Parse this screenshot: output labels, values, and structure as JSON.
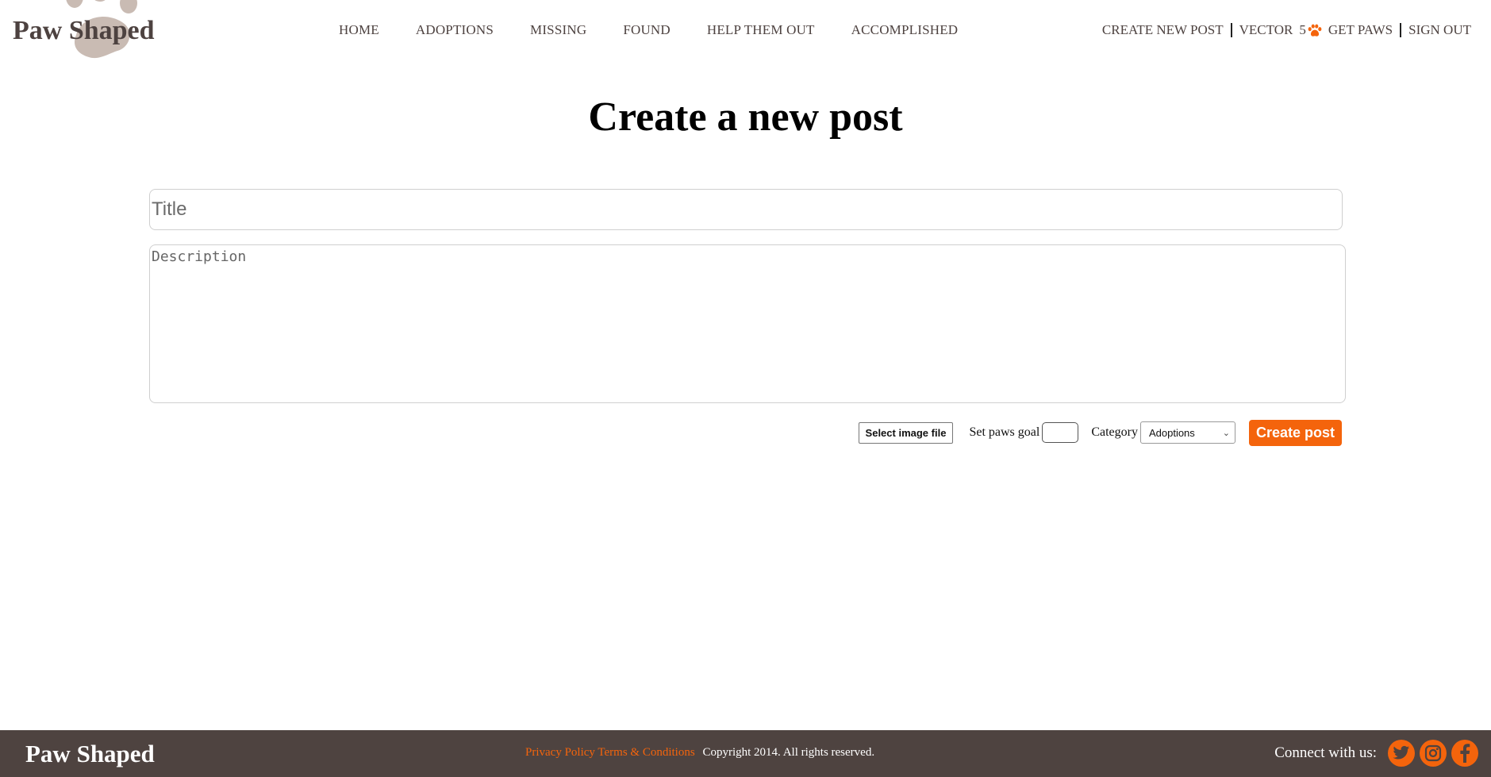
{
  "brand": {
    "name": "Paw Shaped"
  },
  "nav": {
    "items": [
      {
        "label": "HOME"
      },
      {
        "label": "ADOPTIONS"
      },
      {
        "label": "MISSING"
      },
      {
        "label": "FOUND"
      },
      {
        "label": "HELP THEM OUT"
      },
      {
        "label": "ACCOMPLISHED"
      }
    ]
  },
  "user_nav": {
    "create_post": "CREATE NEW POST",
    "username": "VECTOR",
    "paws_count": "5",
    "get_paws": "GET PAWS",
    "sign_out": "SIGN OUT"
  },
  "page": {
    "title": "Create a new post"
  },
  "form": {
    "title_placeholder": "Title",
    "description_placeholder": "Description",
    "select_image_label": "Select image file",
    "paws_goal_label": "Set paws goal",
    "paws_goal_value": "",
    "category_label": "Category",
    "category_selected": "Adoptions",
    "submit_label": "Create post"
  },
  "footer": {
    "brand": "Paw Shaped",
    "privacy": "Privacy Policy",
    "terms": "Terms & Conditions",
    "copyright": "Copyright 2014. All rights reserved.",
    "connect_label": "Connect with us:",
    "social": [
      "twitter-icon",
      "instagram-icon",
      "facebook-icon"
    ]
  },
  "colors": {
    "accent": "#f4640c",
    "brown": "#4e4340",
    "logo_paw": "#c9bbb3"
  }
}
